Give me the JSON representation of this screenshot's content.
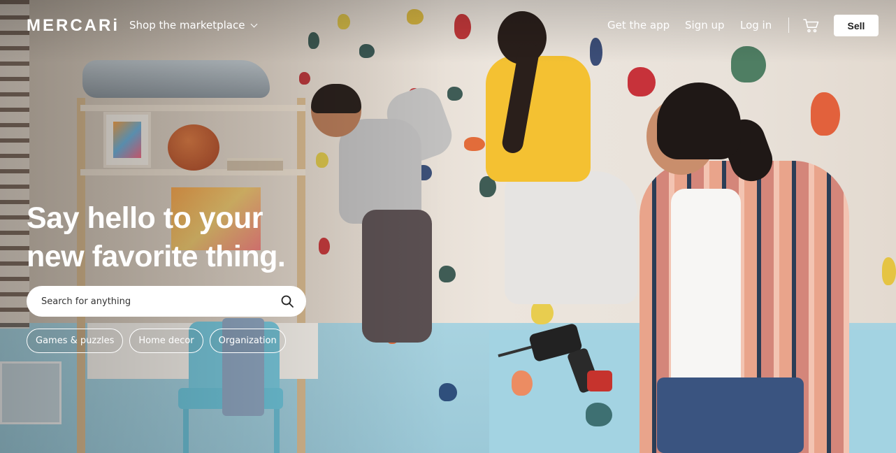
{
  "header": {
    "logo": "MERCARi",
    "shop_menu_label": "Shop the marketplace",
    "get_app_label": "Get the app",
    "sign_up_label": "Sign up",
    "log_in_label": "Log in",
    "cart_icon": "cart-icon",
    "sell_label": "Sell"
  },
  "hero": {
    "headline_line1": "Say hello to your",
    "headline_line2": "new favorite thing.",
    "search": {
      "placeholder": "Search for anything",
      "value": "",
      "icon": "search-icon"
    },
    "chips": [
      {
        "label": "Games & puzzles"
      },
      {
        "label": "Home decor"
      },
      {
        "label": "Organization"
      }
    ]
  },
  "colors": {
    "header_text": "#ffffff",
    "sell_button_bg": "#ffffff",
    "sell_button_text": "#222222",
    "search_bg": "#ffffff"
  }
}
